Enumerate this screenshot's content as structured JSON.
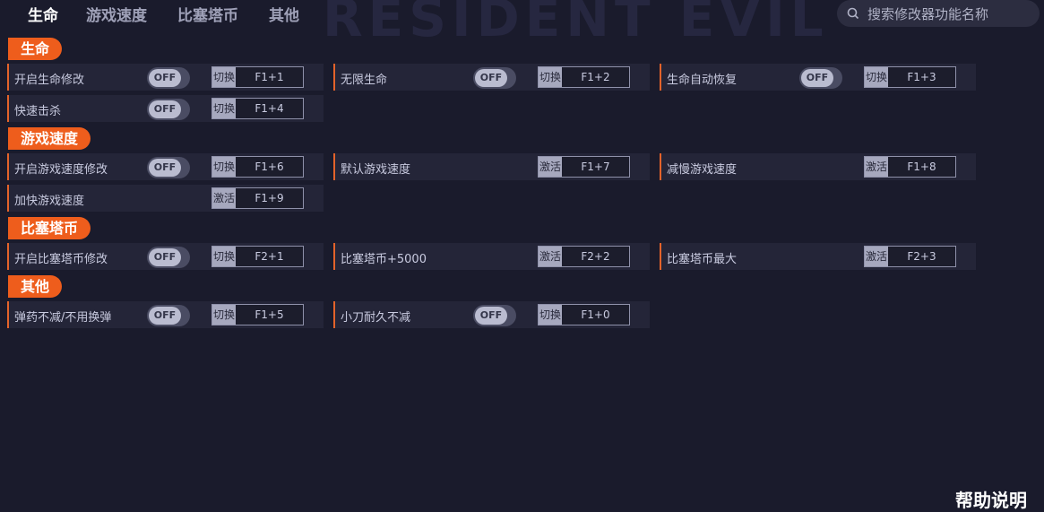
{
  "banner_text": "RESIDENT EVIL",
  "tabs": [
    "生命",
    "游戏速度",
    "比塞塔币",
    "其他"
  ],
  "search": {
    "placeholder": "搜索修改器功能名称"
  },
  "toggle_off": "OFF",
  "sections": [
    {
      "title": "生命",
      "rows": [
        {
          "label": "开启生命修改",
          "toggle": true,
          "action": "切换",
          "hotkey": "F1+1"
        },
        {
          "label": "无限生命",
          "toggle": true,
          "action": "切换",
          "hotkey": "F1+2"
        },
        {
          "label": "生命自动恢复",
          "toggle": true,
          "action": "切换",
          "hotkey": "F1+3"
        },
        {
          "label": "快速击杀",
          "toggle": true,
          "action": "切换",
          "hotkey": "F1+4"
        }
      ]
    },
    {
      "title": "游戏速度",
      "rows": [
        {
          "label": "开启游戏速度修改",
          "toggle": true,
          "action": "切换",
          "hotkey": "F1+6"
        },
        {
          "label": "默认游戏速度",
          "toggle": false,
          "action": "激活",
          "hotkey": "F1+7"
        },
        {
          "label": "减慢游戏速度",
          "toggle": false,
          "action": "激活",
          "hotkey": "F1+8"
        },
        {
          "label": "加快游戏速度",
          "toggle": false,
          "action": "激活",
          "hotkey": "F1+9"
        }
      ]
    },
    {
      "title": "比塞塔币",
      "rows": [
        {
          "label": "开启比塞塔币修改",
          "toggle": true,
          "action": "切换",
          "hotkey": "F2+1"
        },
        {
          "label": "比塞塔币+5000",
          "toggle": false,
          "action": "激活",
          "hotkey": "F2+2"
        },
        {
          "label": "比塞塔币最大",
          "toggle": false,
          "action": "激活",
          "hotkey": "F2+3"
        }
      ]
    },
    {
      "title": "其他",
      "rows": [
        {
          "label": "弹药不减/不用换弹",
          "toggle": true,
          "action": "切换",
          "hotkey": "F1+5"
        },
        {
          "label": "小刀耐久不减",
          "toggle": true,
          "action": "切换",
          "hotkey": "F1+0"
        }
      ]
    }
  ],
  "help_label": "帮助说明",
  "colors": {
    "accent": "#ee5d1c",
    "background": "#1a1b2c",
    "row": "#242538"
  }
}
